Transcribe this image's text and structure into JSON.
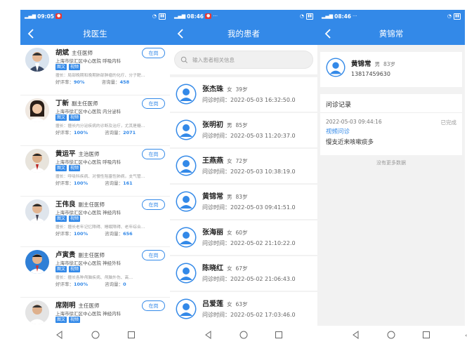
{
  "status_bar": [
    {
      "time": "09:05",
      "battery": ""
    },
    {
      "time": "08:46",
      "battery": ""
    },
    {
      "time": "08:46",
      "battery": ""
    }
  ],
  "screen1": {
    "title": "找医生",
    "consult_label": "在岗",
    "tags": [
      "图文",
      "视频"
    ],
    "doctors": [
      {
        "name": "胡斌",
        "title": "主任医师",
        "hospital": "上海市徐汇区中心医院 呼吸内科",
        "specialty": "擅长：局部晚期和晚期肺部肿瘤的化疗、分子靶…",
        "rating_label": "好评率：",
        "rating": "90%",
        "count_label": "咨询量：",
        "count": "458"
      },
      {
        "name": "丁新",
        "title": "副主任医师",
        "hospital": "上海市徐汇区中心医院 内分泌科",
        "specialty": "擅长：擅长内分泌疾病的诊断及治疗，尤其是糖…",
        "rating_label": "好评率：",
        "rating": "100%",
        "count_label": "咨询量：",
        "count": "2071"
      },
      {
        "name": "黄运平",
        "title": "主治医师",
        "hospital": "上海市徐汇区中心医院 呼吸内科",
        "specialty": "擅长：呼吸科疾病、对慢性阻塞性肺病，支气管…",
        "rating_label": "好评率：",
        "rating": "100%",
        "count_label": "咨询量：",
        "count": "161"
      },
      {
        "name": "王伟良",
        "title": "副主任医师",
        "hospital": "上海市徐汇区中心医院 神经内科",
        "specialty": "擅长：擅长老年记忆障碍、睡眠障碍、老年综合…",
        "rating_label": "好评率：",
        "rating": "100%",
        "count_label": "咨询量：",
        "count": "656"
      },
      {
        "name": "卢寅贵",
        "title": "副主任医师",
        "hospital": "上海市徐汇区中心医院 神经外科",
        "specialty": "擅长：擅长各种颅脑疾病、颅脑外伤、高…",
        "rating_label": "好评率：",
        "rating": "100%",
        "count_label": "咨询量：",
        "count": "0"
      },
      {
        "name": "席刚明",
        "title": "主任医师",
        "hospital": "上海市徐汇区中心医院 神经内科",
        "specialty": "",
        "rating_label": "",
        "rating": "",
        "count_label": "",
        "count": ""
      }
    ]
  },
  "screen2": {
    "title": "我的患者",
    "search_placeholder": "输入患者相关信息",
    "time_label": "问诊时间：",
    "patients": [
      {
        "name": "张杰珠",
        "gender": "女",
        "age": "39岁",
        "time": "2022-05-03 16:32:50.0"
      },
      {
        "name": "张明初",
        "gender": "男",
        "age": "85岁",
        "time": "2022-05-03 11:20:37.0"
      },
      {
        "name": "王燕燕",
        "gender": "女",
        "age": "72岁",
        "time": "2022-05-03 10:38:19.0"
      },
      {
        "name": "黄锦常",
        "gender": "男",
        "age": "83岁",
        "time": "2022-05-03 09:41:51.0"
      },
      {
        "name": "张海丽",
        "gender": "女",
        "age": "60岁",
        "time": "2022-05-02 21:10:22.0"
      },
      {
        "name": "陈晓红",
        "gender": "女",
        "age": "67岁",
        "time": "2022-05-02 21:06:43.0"
      },
      {
        "name": "吕爱莲",
        "gender": "女",
        "age": "63岁",
        "time": "2022-05-02 17:03:46.0"
      }
    ]
  },
  "screen3": {
    "title": "黄锦常",
    "patient": {
      "name": "黄锦常",
      "gender": "男",
      "age": "83岁",
      "phone": "13817459630"
    },
    "records_header": "问诊记录",
    "record": {
      "time": "2022-05-03 09:44:16",
      "status": "已完成",
      "type": "视频问诊",
      "complaint": "慢支近来咳嗽痰多"
    },
    "no_more": "没有更多数据",
    "stray_char": "‹"
  },
  "colors": {
    "primary": "#3389e8",
    "background": "#f2f2f2"
  }
}
